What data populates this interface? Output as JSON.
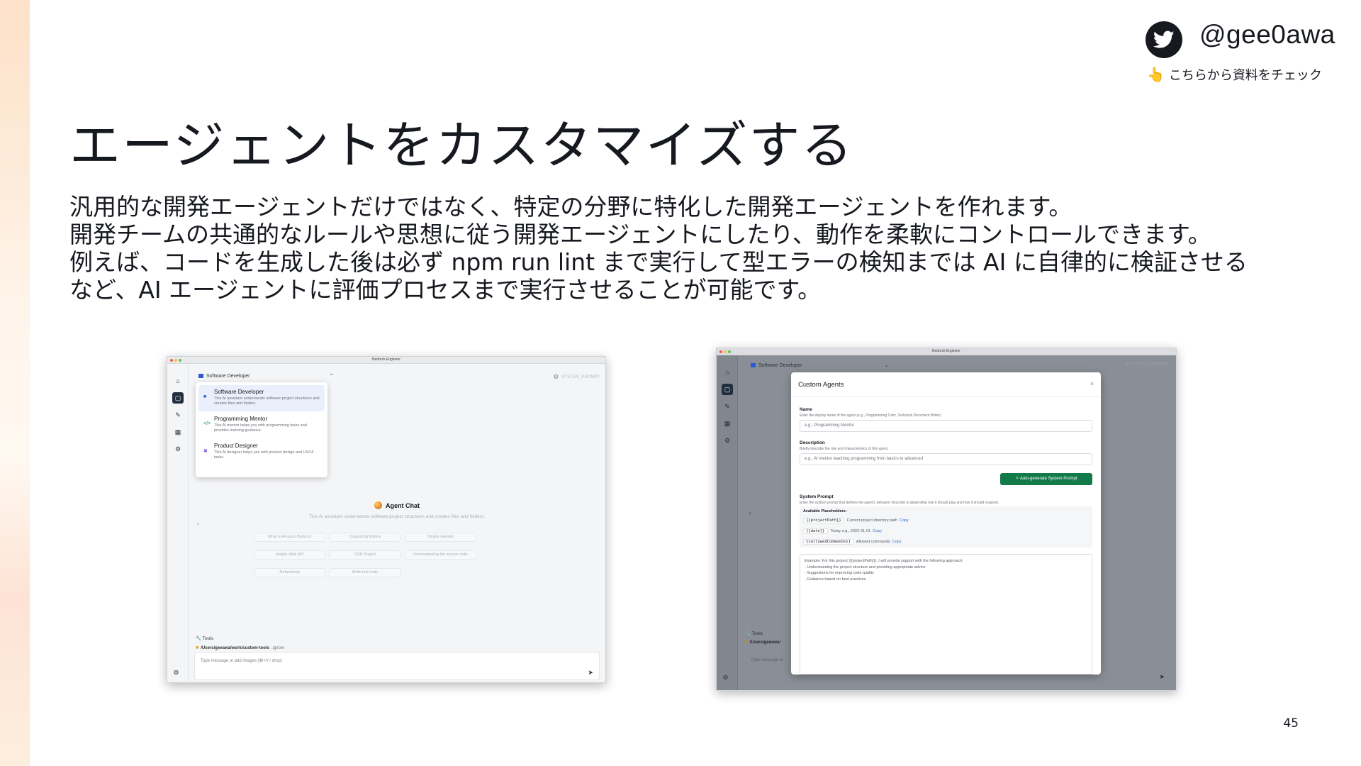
{
  "brand": {
    "handle": "@gee0awa",
    "note": "こちらから資料をチェック",
    "hand_glyph": "👆",
    "icon": "twitter-bird-icon"
  },
  "slide": {
    "title": "エージェントをカスタマイズする",
    "body": [
      "汎用的な開発エージェントだけではなく、特定の分野に特化した開発エージェントを作れます。",
      "開発チームの共通的なルールや思想に従う開発エージェントにしたり、動作を柔軟にコントロールできます。",
      "例えば、コードを生成した後は必ず npm run lint まで実行して型エラーの検知までは AI に自律的に検証させる",
      "など、AI エージェントに評価プロセスまで実行させることが可能です。"
    ],
    "page_number": "45"
  },
  "shot1": {
    "window_title": "Bedrock Engineer",
    "agent_selector": "Software Developer",
    "system_prompt": "SYSTEM_PROMPT",
    "agents": [
      {
        "name": "Software Developer",
        "desc": "This AI assistant understands software project structures and creates files and folders.",
        "icon": "code-square-icon",
        "color": "#2a5bd7"
      },
      {
        "name": "Programming Mentor",
        "desc": "This AI mentor helps you with programming tasks and provides learning guidance.",
        "icon": "code-brackets-icon",
        "color": "#1f8a5b"
      },
      {
        "name": "Product Designer",
        "desc": "This AI designer helps you with product design and UX/UI tasks.",
        "icon": "design-tools-icon",
        "color": "#7a4fd3"
      }
    ],
    "chat_title": "Agent Chat",
    "chat_subtitle": "This AI assistant understands software project structures and creates files and folders.",
    "suggestions": [
      "What is Amazon Bedrock",
      "Organizing folders",
      "Simple website",
      "Simple Web API",
      "CDK Project",
      "Understanding the source code",
      "Refactoring",
      "Write test code"
    ],
    "tools_label": "Tools",
    "project_path": "/Users/geeawa/work/custom-tools",
    "ignore_label": ".ignore",
    "message_placeholder": "Type message or add images (⌘+V / drop)"
  },
  "shot2": {
    "window_title": "Bedrock Engineer",
    "agent_selector": "Software Developer",
    "system_prompt": "SYSTEM_PROMPT",
    "tools_label": "Tools",
    "project_path": "/Users/geeawa/",
    "message_placeholder": "Type message or",
    "modal": {
      "title": "Custom Agents",
      "name_label": "Name",
      "name_hint": "Enter the display name of the agent (e.g., Programming Tutor, Technical Document Writer)",
      "name_placeholder": "e.g., Programming Mentor",
      "desc_label": "Description",
      "desc_hint": "Briefly describe the role and characteristics of this agent.",
      "desc_placeholder": "e.g., AI mentor teaching programming from basics to advanced",
      "generate_button": "Auto-generate System Prompt",
      "sys_label": "System Prompt",
      "sys_hint": "Enter the system prompt that defines the agent's behavior Describe in detail what role it should play and how it should respond.",
      "placeholders_title": "Available Placeholders:",
      "placeholders": [
        {
          "code": "{{projectPath}}",
          "desc": "Current project directory path",
          "copy": "Copy"
        },
        {
          "code": "{{date}}",
          "desc": "Today e.g., 2022-01-01",
          "copy": "Copy"
        },
        {
          "code": "{{allowedCommands}}",
          "desc": "Allowed commands",
          "copy": "Copy"
        }
      ],
      "example": [
        "Example: For this project ({{projectPath}}), I will provide support with the following approach:",
        "- Understanding the project structure and providing appropriate advice",
        "- Suggestions for improving code quality",
        "- Guidance based on best practices"
      ]
    }
  },
  "colors": {
    "accent_green": "#137a4a",
    "sidebar_active": "#232f3e",
    "left_band": "#fde1c8"
  }
}
